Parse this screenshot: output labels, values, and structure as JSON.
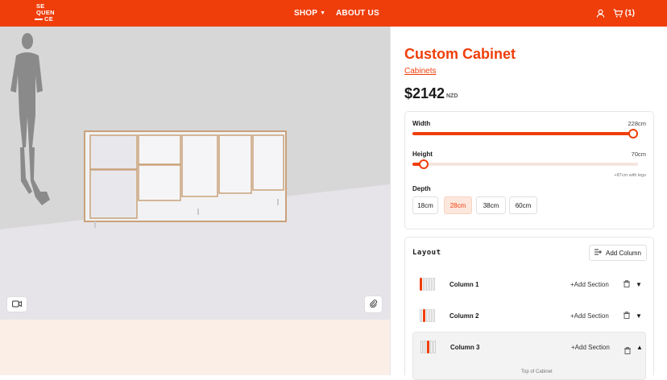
{
  "header": {
    "logo_lines": [
      "SE",
      "QUEN",
      "CE"
    ],
    "nav": {
      "shop": "SHOP",
      "about": "ABOUT US"
    },
    "cart_count": "(1)",
    "icons": [
      "user-icon",
      "cart-icon"
    ],
    "brand_color": "#ef3e0a"
  },
  "product": {
    "title": "Custom Cabinet",
    "category": "Cabinets",
    "price": "$2142",
    "currency": "NZD"
  },
  "dimensions": {
    "width": {
      "label": "Width",
      "value": "228cm",
      "fraction": 0.98
    },
    "height": {
      "label": "Height",
      "value": "70cm",
      "fraction": 0.05,
      "note": "+87cm with legs"
    },
    "depth": {
      "label": "Depth",
      "options": [
        "18cm",
        "28cm",
        "38cm",
        "60cm"
      ],
      "selected": "28cm"
    }
  },
  "layout": {
    "title": "Layout",
    "add_column": "Add Column",
    "columns": [
      {
        "name": "Column 1",
        "add_section": "+Add Section",
        "expanded": false
      },
      {
        "name": "Column 2",
        "add_section": "+Add Section",
        "expanded": false
      },
      {
        "name": "Column 3",
        "add_section": "+Add Section",
        "expanded": true
      }
    ],
    "expanded_item": "Top of Cabinet"
  },
  "viewer_icons": [
    "video-camera-icon",
    "paperclip-icon"
  ]
}
